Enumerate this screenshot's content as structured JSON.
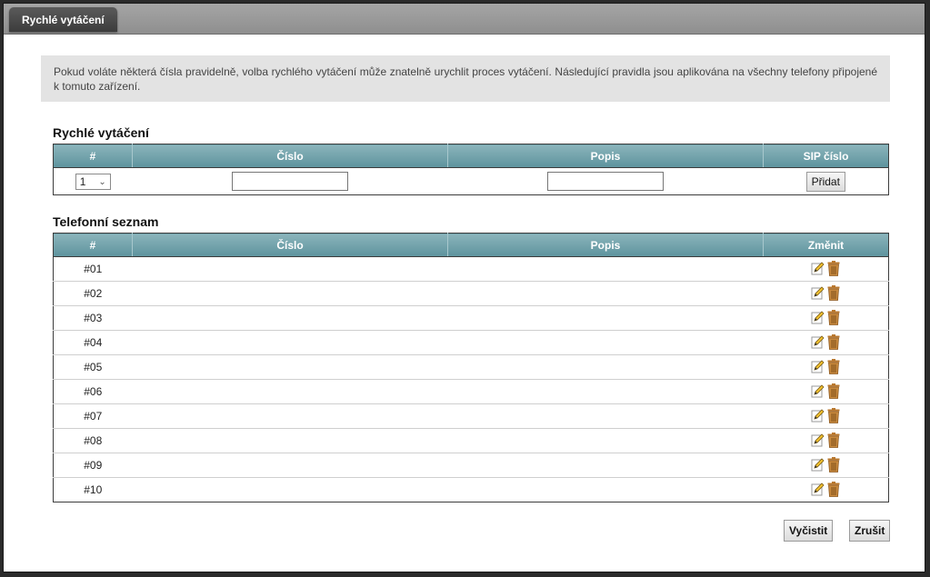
{
  "tab": {
    "title": "Rychlé vytáčení"
  },
  "info_text": "Pokud voláte některá čísla pravidelně, volba rychlého vytáčení může znatelně urychlit proces vytáčení. Následující pravidla jsou aplikována na všechny telefony připojené k tomuto zařízení.",
  "speed_dial": {
    "title": "Rychlé vytáčení",
    "headers": [
      "#",
      "Číslo",
      "Popis",
      "SIP číslo"
    ],
    "select_value": "1",
    "number_value": "",
    "description_value": "",
    "add_label": "Přidat"
  },
  "phonebook": {
    "title": "Telefonní seznam",
    "headers": [
      "#",
      "Číslo",
      "Popis",
      "Změnit"
    ],
    "rows": [
      {
        "id": "#01"
      },
      {
        "id": "#02"
      },
      {
        "id": "#03"
      },
      {
        "id": "#04"
      },
      {
        "id": "#05"
      },
      {
        "id": "#06"
      },
      {
        "id": "#07"
      },
      {
        "id": "#08"
      },
      {
        "id": "#09"
      },
      {
        "id": "#10"
      }
    ]
  },
  "footer": {
    "clear_label": "Vyčistit",
    "cancel_label": "Zrušit"
  },
  "colors": {
    "header_teal": "#5d939d",
    "tab_dark": "#3c3c3c",
    "info_bg": "#e3e3e3"
  }
}
